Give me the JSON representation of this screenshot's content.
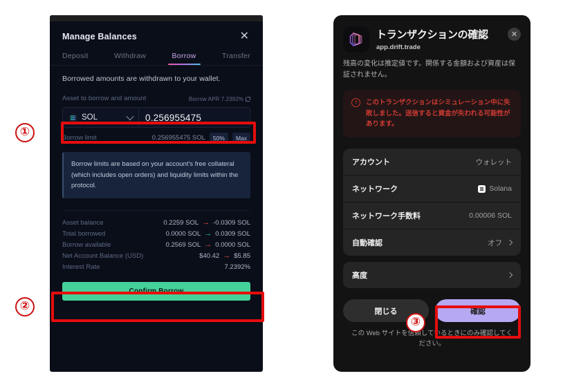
{
  "left_panel": {
    "title": "Manage Balances",
    "close_label": "✕",
    "tabs": [
      {
        "label": "Deposit",
        "active": false
      },
      {
        "label": "Withdraw",
        "active": false
      },
      {
        "label": "Borrow",
        "active": true
      },
      {
        "label": "Transfer",
        "active": false
      }
    ],
    "note": "Borrowed amounts are withdrawn to your wallet.",
    "asset_label": "Asset to borrow and amount",
    "apr_label": "Borrow APR 7.2392%",
    "asset_symbol": "SOL",
    "amount_value": "0.256955475",
    "borrow_limit_label": "Borrow limit",
    "borrow_limit_value": "0.256955475 SOL",
    "chip_half": "50%",
    "chip_max": "Max",
    "info_text": "Borrow limits are based on your account's free collateral (which includes open orders) and liquidity limits within the protocol.",
    "stats": [
      {
        "label": "Asset balance",
        "from": "0.2259 SOL",
        "arrow": "→",
        "arrow_color": "red",
        "to": "-0.0309 SOL"
      },
      {
        "label": "Total borrowed",
        "from": "0.0000 SOL",
        "arrow": "→",
        "arrow_color": "green",
        "to": "0.0309 SOL"
      },
      {
        "label": "Borrow available",
        "from": "0.2569 SOL",
        "arrow": "→",
        "arrow_color": "red",
        "to": "0.0000 SOL"
      },
      {
        "label": "Net Account Balance (USD)",
        "from": "$40.42",
        "arrow": "→",
        "arrow_color": "red",
        "to": "$5.85"
      },
      {
        "label": "Interest Rate",
        "from": "",
        "arrow": "",
        "arrow_color": "none",
        "to": "7.2392%"
      }
    ],
    "confirm_label": "Confirm Borrow",
    "accent_green": "#45d19a",
    "accent_tab": "#c9a8e8"
  },
  "right_panel": {
    "title": "トランザクションの確認",
    "domain": "app.drift.trade",
    "close_label": "✕",
    "subtitle": "残高の変化は推定値です。関係する金額および資産は保証されません。",
    "alert_text": "このトランザクションはシミュレーション中に失敗しました。送信すると資金が失われる可能性があります。",
    "alert_color": "#cf3b33",
    "rows": [
      {
        "label": "アカウント",
        "value": "ウォレット",
        "badge": false,
        "chevron": false
      },
      {
        "label": "ネットワーク",
        "value": "Solana",
        "badge": true,
        "chevron": false
      },
      {
        "label": "ネットワーク手数料",
        "value": "0.00006 SOL",
        "badge": false,
        "chevron": false
      },
      {
        "label": "自動確認",
        "value": "オフ",
        "badge": false,
        "chevron": true
      }
    ],
    "advanced_row": {
      "label": "高度",
      "value": "",
      "chevron": true
    },
    "close_button": "閉じる",
    "confirm_button": "確認",
    "footer": "この Web サイトを信頼しているときにのみ確認してください。",
    "confirm_color": "#b6a8f2"
  },
  "annotations": {
    "markers": [
      {
        "number": "①"
      },
      {
        "number": "②"
      },
      {
        "number": "③"
      }
    ],
    "highlight_color": "#e60d0d"
  }
}
